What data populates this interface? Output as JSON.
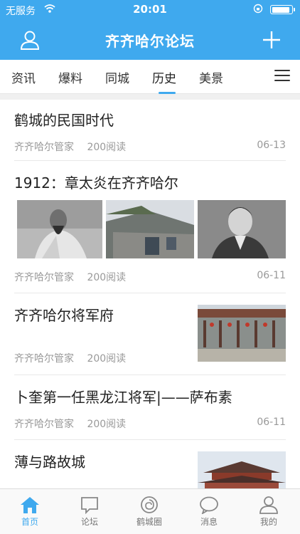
{
  "status_bar": {
    "carrier": "无服务",
    "time": "20:01"
  },
  "navbar": {
    "title": "齐齐哈尔论坛"
  },
  "tabs": [
    {
      "label": "资讯"
    },
    {
      "label": "爆料"
    },
    {
      "label": "同城"
    },
    {
      "label": "历史"
    },
    {
      "label": "美景"
    }
  ],
  "active_tab": "历史",
  "articles": [
    {
      "title": "鹤城的民国时代",
      "author": "齐齐哈尔管家",
      "reads": "200阅读",
      "date": "06-13"
    },
    {
      "title": "1912：章太炎在齐齐哈尔",
      "author": "齐齐哈尔管家",
      "reads": "200阅读",
      "date": "06-11"
    },
    {
      "title": "齐齐哈尔将军府",
      "author": "齐齐哈尔管家",
      "reads": "200阅读",
      "date": ""
    },
    {
      "title": "卜奎第一任黑龙江将军|——萨布素",
      "author": "齐齐哈尔管家",
      "reads": "200阅读",
      "date": "06-11"
    },
    {
      "title": "薄与路故城",
      "author": "",
      "reads": "",
      "date": ""
    }
  ],
  "bottom_tabs": [
    {
      "label": "首页",
      "icon": "home-icon"
    },
    {
      "label": "论坛",
      "icon": "forum-icon"
    },
    {
      "label": "鹤城圈",
      "icon": "circle-icon"
    },
    {
      "label": "消息",
      "icon": "message-icon"
    },
    {
      "label": "我的",
      "icon": "profile-icon"
    }
  ],
  "colors": {
    "accent": "#3fa9ee",
    "text": "#222222",
    "meta": "#999999"
  }
}
